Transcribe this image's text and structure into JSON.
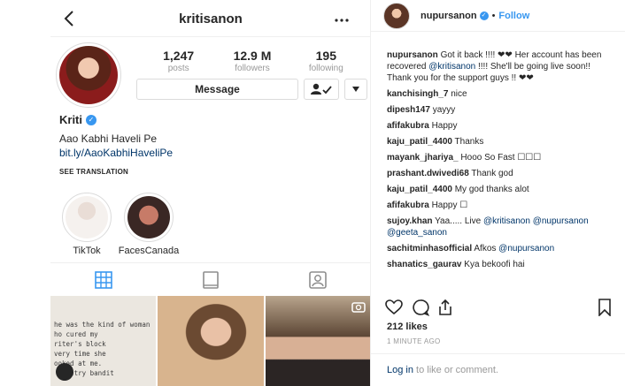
{
  "profile": {
    "username": "kritisanon",
    "stats": [
      {
        "value": "1,247",
        "label": "posts"
      },
      {
        "value": "12.9 M",
        "label": "followers"
      },
      {
        "value": "195",
        "label": "following"
      }
    ],
    "message_label": "Message",
    "name": "Kriti",
    "verified_glyph": "✓",
    "bio": "Aao Kabhi Haveli Pe",
    "link": "bit.ly/AaoKabhiHaveliPe",
    "translation_label": "SEE TRANSLATION",
    "highlights": [
      {
        "label": "TikTok"
      },
      {
        "label": "FacesCanada"
      }
    ],
    "tabs": [
      "grid-icon",
      "igtv-icon",
      "tagged-icon"
    ],
    "poem_lines": [
      "he was the kind of woman",
      "ho cured my",
      "riter's block",
      "very time she",
      "ooked at me.",
      "  poetry bandit"
    ]
  },
  "post": {
    "username": "nupursanon",
    "verified_glyph": "✓",
    "separator": "•",
    "follow_label": "Follow",
    "comments": [
      {
        "user": "nupursanon",
        "parts": [
          {
            "t": "Got it back !!!! ❤❤ Her account has been recovered "
          },
          {
            "m": "@kritisanon"
          },
          {
            "t": " !!!! She'll be going live soon!! Thank you for the support guys !! ❤❤"
          }
        ]
      },
      {
        "user": "kanchisingh_7",
        "parts": [
          {
            "t": "nice"
          }
        ]
      },
      {
        "user": "dipesh147",
        "parts": [
          {
            "t": "yayyy"
          }
        ]
      },
      {
        "user": "afifakubra",
        "parts": [
          {
            "t": "Happy"
          }
        ]
      },
      {
        "user": "kaju_patil_4400",
        "parts": [
          {
            "t": "Thanks"
          }
        ]
      },
      {
        "user": "mayank_jhariya_",
        "parts": [
          {
            "t": "Hooo So Fast ☐☐☐"
          }
        ]
      },
      {
        "user": "prashant.dwivedi68",
        "parts": [
          {
            "t": "Thank god"
          }
        ]
      },
      {
        "user": "kaju_patil_4400",
        "parts": [
          {
            "t": "My god thanks alot"
          }
        ]
      },
      {
        "user": "afifakubra",
        "parts": [
          {
            "t": "Happy ☐"
          }
        ]
      },
      {
        "user": "sujoy.khan",
        "parts": [
          {
            "t": "Yaa..... Live "
          },
          {
            "m": "@kritisanon"
          },
          {
            "t": " "
          },
          {
            "m": "@nupursanon"
          },
          {
            "t": " "
          },
          {
            "m": "@geeta_sanon"
          }
        ]
      },
      {
        "user": "sachitminhasofficial",
        "parts": [
          {
            "t": "Afkos "
          },
          {
            "m": "@nupursanon"
          }
        ]
      },
      {
        "user": "shanatics_gaurav",
        "parts": [
          {
            "t": "Kya bekoofi hai"
          }
        ]
      }
    ],
    "likes": "212 likes",
    "time": "1 MINUTE AGO",
    "login_link": "Log in",
    "login_rest": " to like or comment."
  },
  "colors": {
    "accent": "#3897f0",
    "link": "#003569",
    "muted": "#999999",
    "border": "#efefef"
  }
}
